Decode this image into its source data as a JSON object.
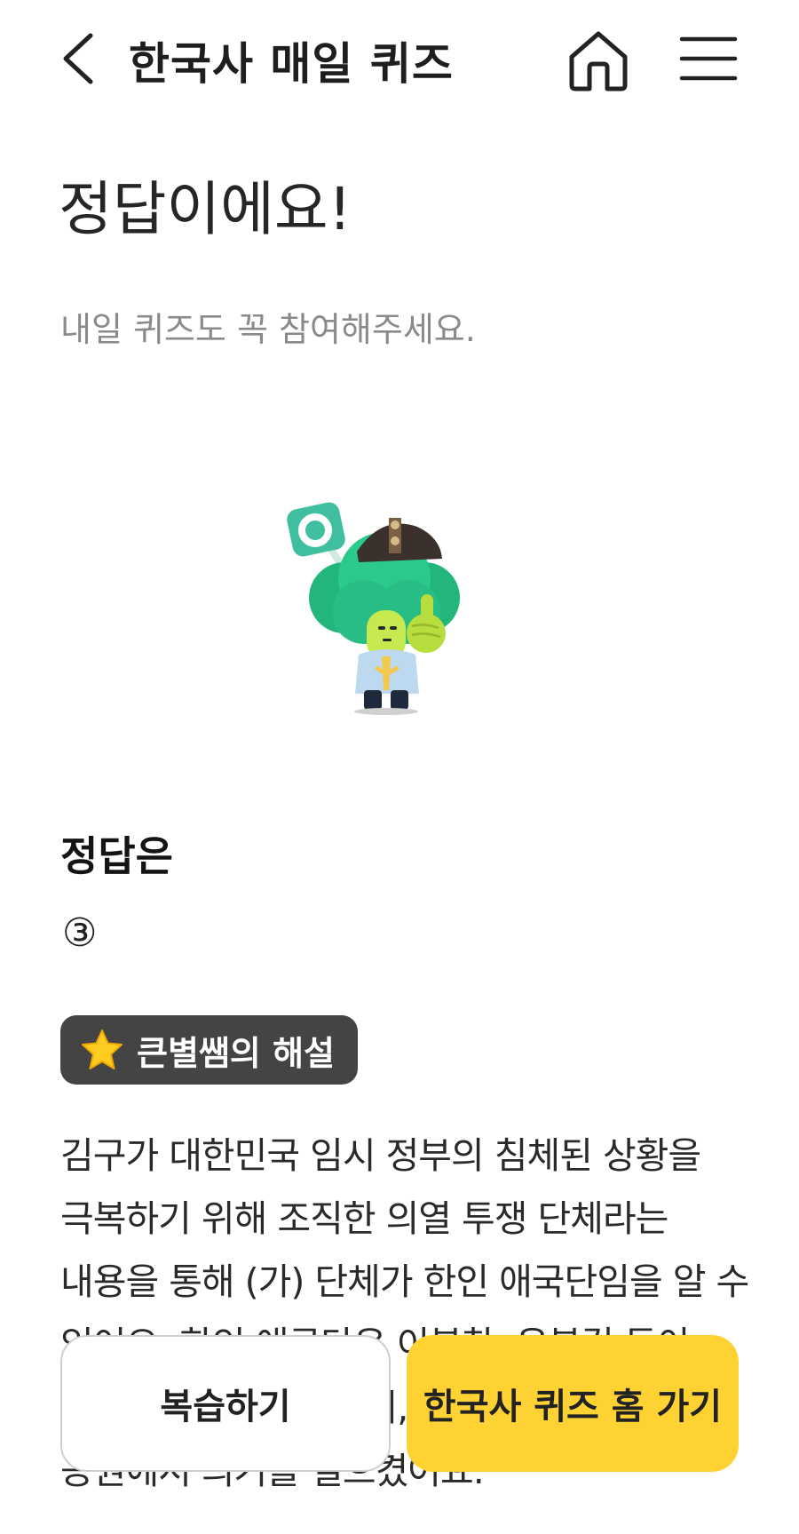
{
  "header": {
    "title": "한국사 매일 퀴즈",
    "back_icon": "chevron-left-icon",
    "home_icon": "home-icon",
    "menu_icon": "hamburger-menu-icon"
  },
  "result": {
    "title": "정답이에요!",
    "subtitle": "내일 퀴즈도 꼭 참여해주세요."
  },
  "mascot": {
    "name": "broccoli-teacher-mascot"
  },
  "answer": {
    "label": "정답은",
    "value": "③"
  },
  "explanation": {
    "badge_icon": "star-icon",
    "badge_label": "큰별쌤의 해설",
    "text": "김구가 대한민국 임시 정부의 침체된 상황을 극복하기 위해 조직한 의열 투쟁 단체라는 내용을 통해 (가) 단체가 한인 애국단임을 알 수 있어요. 한인 애국단은 이봉창, 윤봉길 등이 소속되어 활동하였으며, 윤봉길은 훙커우 공원에서 의거를 일으켰어요."
  },
  "buttons": {
    "review_label": "복습하기",
    "home_label": "한국사 퀴즈 홈 가기"
  },
  "colors": {
    "accent_yellow": "#ffd234",
    "badge_bg": "#444444",
    "mascot_green": "#2ecc8f",
    "text_primary": "#222222",
    "text_secondary": "#8a8a8a"
  }
}
